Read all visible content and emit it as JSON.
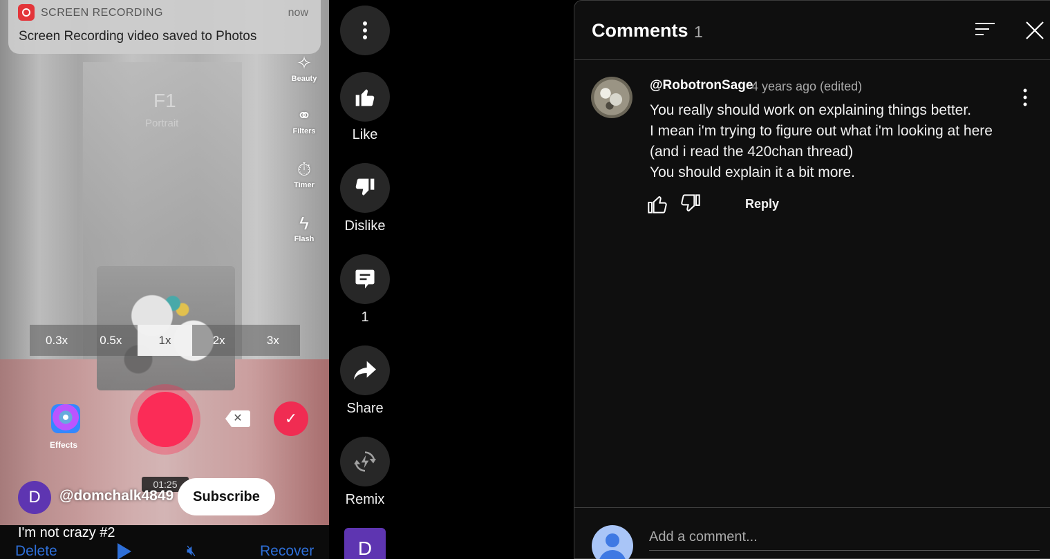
{
  "notification": {
    "app": "SCREEN RECORDING",
    "time": "now",
    "message": "Screen Recording video saved to Photos"
  },
  "camera": {
    "filter_name": "F1",
    "filter_sub": "Portrait",
    "tools": [
      {
        "label": "Beauty",
        "icon": "beauty-wand-icon"
      },
      {
        "label": "Filters",
        "icon": "filters-circles-icon"
      },
      {
        "label": "Timer",
        "icon": "timer-icon"
      },
      {
        "label": "Flash",
        "icon": "flash-off-icon"
      }
    ],
    "zoom_options": [
      "0.3x",
      "0.5x",
      "1x",
      "2x",
      "3x"
    ],
    "zoom_selected": "1x",
    "effects_label": "Effects",
    "timecode": "01:25"
  },
  "video_controls": {
    "delete": "Delete",
    "recover": "Recover"
  },
  "channel": {
    "avatar_letter": "D",
    "handle": "@domchalk4849",
    "subscribe_label": "Subscribe",
    "avatar_color": "#5e35b1"
  },
  "video": {
    "title": "I'm not crazy #2"
  },
  "actions": {
    "like": "Like",
    "dislike": "Dislike",
    "comment_count": "1",
    "share": "Share",
    "remix": "Remix",
    "mini_avatar_letter": "D"
  },
  "comments_panel": {
    "title": "Comments",
    "count": "1",
    "comment": {
      "author": "@RobotronSage",
      "meta": "4 years ago (edited)",
      "lines": [
        "You really should work on explaining things better.",
        "I mean i'm trying to figure out what i'm looking at here",
        "(and i read the 420chan thread)",
        "You should explain it a bit more."
      ],
      "reply_label": "Reply"
    },
    "add_comment_placeholder": "Add a comment..."
  },
  "colors": {
    "accent_red": "#fb2c57",
    "panel_bg": "#0f0f0f",
    "button_bg": "#272727",
    "link_blue": "#2e6fd8"
  }
}
